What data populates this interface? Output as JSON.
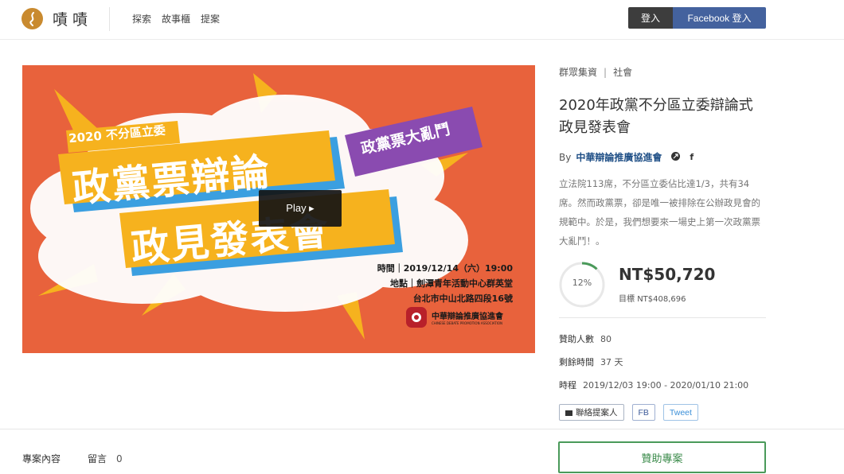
{
  "header": {
    "brand": "嘖嘖",
    "nav": [
      "探索",
      "故事櫃",
      "提案"
    ],
    "login_label": "登入",
    "facebook_login_label": "Facebook 登入"
  },
  "hero": {
    "play_label": "Play ▸",
    "poster": {
      "small_title": "2020 不分區立委",
      "line1": "政黨票辯論",
      "line2": "政見發表會",
      "tag": "政黨票大亂鬥",
      "time": "時間｜2019/12/14（六）19:00",
      "place": "地點｜劍潭青年活動中心群英堂",
      "address": "台北市中山北路四段16號",
      "org_name": "中華辯論推廣協進會",
      "org_en": "CHINESE DEBATE PROMOTION ASSOCIATION"
    }
  },
  "project": {
    "category": "群眾集資",
    "subcategory": "社會",
    "title": "2020年政黨不分區立委辯論式政見發表會",
    "by_label": "By",
    "author": "中華辯論推廣協進會",
    "description": "立法院113席，不分區立委佔比達1/3，共有34席。然而政黨票，卻是唯一被排除在公辦政見會的規範中。於是，我們想要來一場史上第一次政黨票大亂鬥！。",
    "progress_label": "12%",
    "progress_fraction": 0.12,
    "amount": "NT$50,720",
    "goal_label": "目標",
    "goal": "NT$408,696",
    "backers_label": "贊助人數",
    "backers": "80",
    "remaining_label": "剩餘時間",
    "remaining": "37 天",
    "period_label": "時程",
    "period": "2019/12/03 19:00 - 2020/01/10 21:00",
    "contact_label": "聯絡提案人",
    "fb_label": "FB",
    "tweet_label": "Tweet"
  },
  "bottom": {
    "tab_content": "專案內容",
    "tab_comments": "留言",
    "comment_count": "0",
    "support_label": "贊助專案"
  },
  "colors": {
    "hero_bg": "#e8623c",
    "poster_yellow": "#f6b21e",
    "poster_purple": "#8a4bb0",
    "poster_blue": "#3b9fe0",
    "author": "#1f4f86",
    "support_green": "#4a9a5a",
    "fb_button": "#44629e"
  }
}
